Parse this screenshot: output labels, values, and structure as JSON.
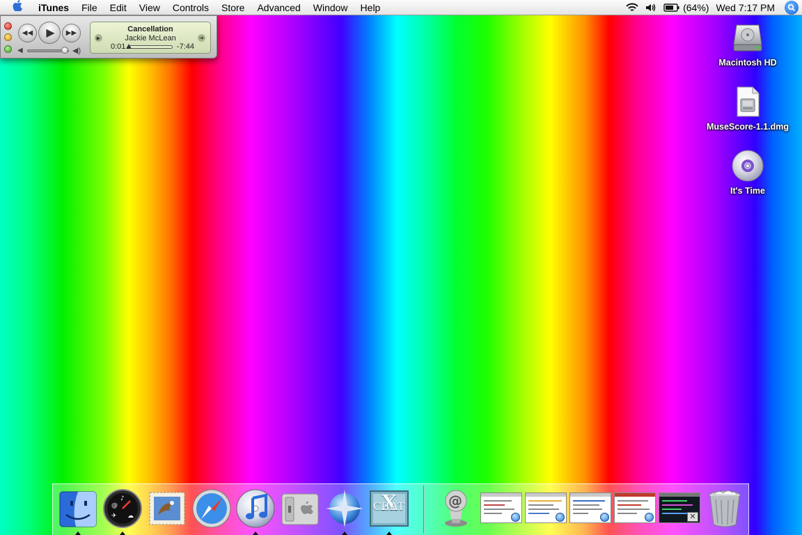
{
  "menubar": {
    "app_name": "iTunes",
    "menus": [
      "File",
      "Edit",
      "View",
      "Controls",
      "Store",
      "Advanced",
      "Window",
      "Help"
    ],
    "battery_percent": "(64%)",
    "clock": "Wed 7:17 PM",
    "status_icons": [
      "wifi-icon",
      "volume-icon",
      "battery-icon",
      "spotlight-icon"
    ]
  },
  "mini_player": {
    "song_title": "Cancellation",
    "artist": "Jackie McLean",
    "elapsed": "0:01",
    "remaining": "-7:44",
    "progress": 0.0,
    "volume": 0.9
  },
  "desktop": {
    "icons": [
      {
        "label": "Macintosh HD",
        "icon": "hard-drive-icon"
      },
      {
        "label": "MuseScore-1.1.dmg",
        "icon": "disk-image-icon"
      },
      {
        "label": "It's Time",
        "icon": "cd-icon"
      }
    ]
  },
  "dock": {
    "apps": [
      "finder-icon",
      "dashboard-icon",
      "mail-icon",
      "safari-icon",
      "itunes-icon",
      "system-preferences-icon",
      "network-globe-icon",
      "x-chat-icon"
    ],
    "right_items": [
      "mail-at-stack-icon",
      "web-thumbnail-1",
      "web-thumbnail-2",
      "web-thumbnail-3",
      "web-thumbnail-4",
      "terminal-thumbnail",
      "trash-icon"
    ],
    "x_chat_label": "CHAT",
    "x_chat_letter": "X"
  },
  "colors": {
    "menubar_bg": "#eeeeee",
    "lcd_bg": "#dfe9c6",
    "label_text": "#ffffff"
  }
}
